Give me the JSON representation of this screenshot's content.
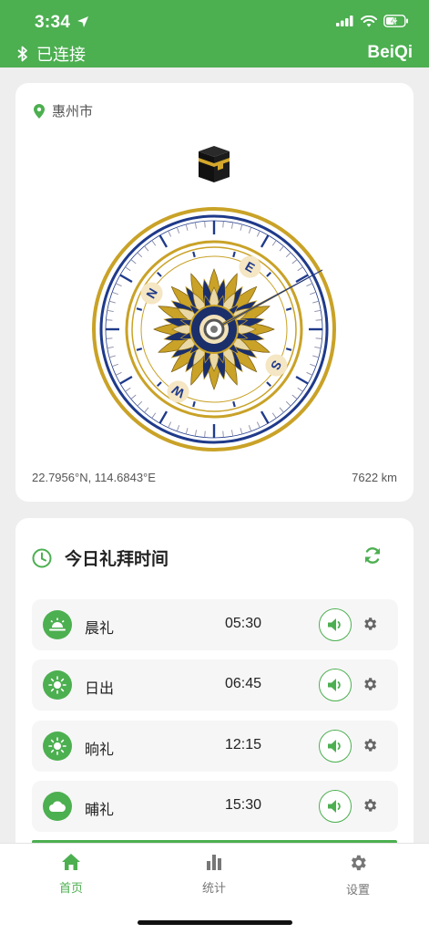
{
  "status_bar": {
    "time": "3:34"
  },
  "header": {
    "bluetooth_status": "已连接",
    "brand": "BeiQi"
  },
  "location": {
    "city": "惠州市",
    "coordinates": "22.7956°N, 114.6843°E",
    "distance": "7622 km"
  },
  "compass": {
    "letters": {
      "n": "N",
      "e": "E",
      "s": "S",
      "w": "W"
    }
  },
  "prayer": {
    "title": "今日礼拜时间",
    "rows": [
      {
        "name": "晨礼",
        "time": "05:30",
        "icon": "sunrise-icon"
      },
      {
        "name": "日出",
        "time": "06:45",
        "icon": "sun-icon"
      },
      {
        "name": "晌礼",
        "time": "12:15",
        "icon": "sun-icon"
      },
      {
        "name": "晡礼",
        "time": "15:30",
        "icon": "cloud-icon"
      }
    ]
  },
  "tabs": [
    {
      "label": "首页",
      "icon": "home-icon"
    },
    {
      "label": "统计",
      "icon": "bar-chart-icon"
    },
    {
      "label": "设置",
      "icon": "gear-icon"
    }
  ],
  "colors": {
    "accent": "#4caf50",
    "gold": "#c9a227",
    "navy": "#1f3a8a"
  }
}
